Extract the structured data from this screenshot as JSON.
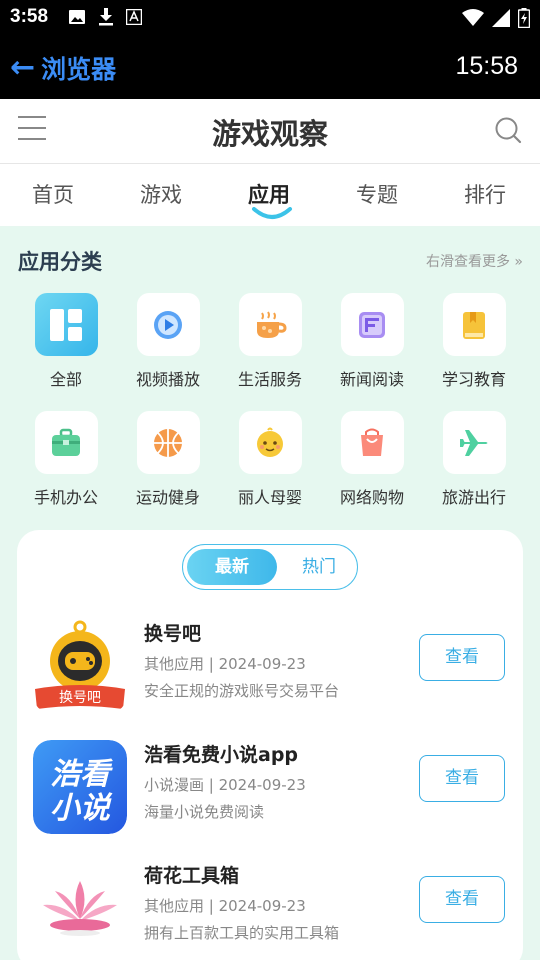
{
  "status": {
    "time": "3:58"
  },
  "browser": {
    "back_label": "浏览器",
    "time": "15:58"
  },
  "header": {
    "title": "游戏观察"
  },
  "tabs": [
    {
      "label": "首页"
    },
    {
      "label": "游戏"
    },
    {
      "label": "应用",
      "active": true
    },
    {
      "label": "专题"
    },
    {
      "label": "排行"
    }
  ],
  "categories": {
    "title": "应用分类",
    "more": "右滑查看更多 »",
    "items": [
      {
        "label": "全部",
        "icon": "grid-icon",
        "active": true
      },
      {
        "label": "视频播放",
        "icon": "video-play-icon"
      },
      {
        "label": "生活服务",
        "icon": "coffee-cup-icon"
      },
      {
        "label": "新闻阅读",
        "icon": "news-icon"
      },
      {
        "label": "学习教育",
        "icon": "book-icon"
      },
      {
        "label": "手机办公",
        "icon": "briefcase-icon"
      },
      {
        "label": "运动健身",
        "icon": "basketball-icon"
      },
      {
        "label": "丽人母婴",
        "icon": "baby-icon"
      },
      {
        "label": "网络购物",
        "icon": "shopping-bag-icon"
      },
      {
        "label": "旅游出行",
        "icon": "airplane-icon"
      }
    ]
  },
  "list": {
    "toggle_new": "最新",
    "toggle_hot": "热门",
    "apps": [
      {
        "name": "换号吧",
        "meta": "其他应用 | 2024-09-23",
        "desc": "安全正规的游戏账号交易平台",
        "button": "查看",
        "icon_text": "换号吧"
      },
      {
        "name": "浩看免费小说app",
        "meta": "小说漫画 | 2024-09-23",
        "desc": "海量小说免费阅读",
        "button": "查看",
        "icon_text_1": "浩看",
        "icon_text_2": "小说"
      },
      {
        "name": "荷花工具箱",
        "meta": "其他应用 | 2024-09-23",
        "desc": "拥有上百款工具的实用工具箱",
        "button": "查看"
      }
    ]
  },
  "colors": {
    "accent": "#3aaee4",
    "section_bg": "#e6f8f0",
    "browser_back": "#3b8cf5"
  }
}
